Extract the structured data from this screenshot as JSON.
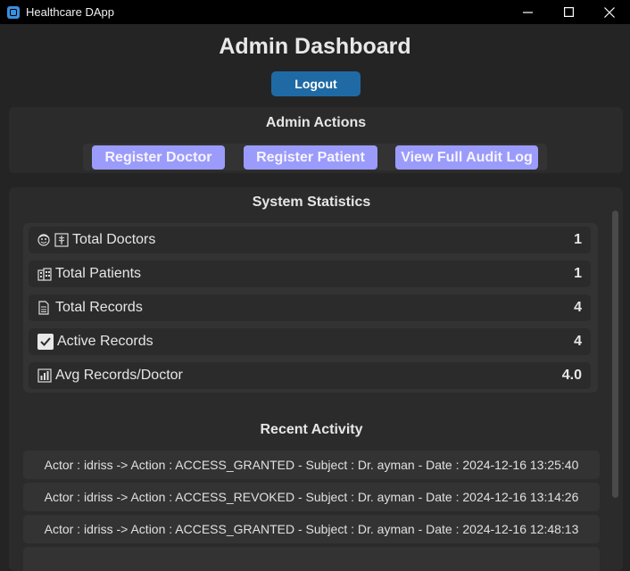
{
  "window": {
    "title": "Healthcare DApp",
    "controls": [
      "minimize",
      "maximize",
      "close"
    ]
  },
  "header": {
    "title": "Admin Dashboard",
    "logout_label": "Logout"
  },
  "admin_actions": {
    "title": "Admin Actions",
    "buttons": [
      {
        "label": "Register Doctor"
      },
      {
        "label": "Register Patient"
      },
      {
        "label": "View Full Audit Log"
      }
    ]
  },
  "statistics": {
    "title": "System Statistics",
    "items": [
      {
        "label": "Total Doctors",
        "value": "1",
        "icons": [
          "doctor-face-icon",
          "medical-badge-icon"
        ]
      },
      {
        "label": "Total Patients",
        "value": "1",
        "icons": [
          "hospital-icon"
        ]
      },
      {
        "label": "Total Records",
        "value": "4",
        "icons": [
          "document-icon"
        ]
      },
      {
        "label": "Active Records",
        "value": "4",
        "icons": [
          "checkmark-icon"
        ]
      },
      {
        "label": "Avg Records/Doctor",
        "value": "4.0",
        "icons": [
          "bar-chart-icon"
        ]
      }
    ]
  },
  "recent_activity": {
    "title": "Recent Activity",
    "items": [
      "Actor : idriss -> Action : ACCESS_GRANTED - Subject : Dr. ayman - Date : 2024-12-16 13:25:40",
      "Actor : idriss -> Action : ACCESS_REVOKED - Subject : Dr. ayman - Date : 2024-12-16 13:14:26",
      "Actor : idriss -> Action : ACCESS_GRANTED - Subject : Dr. ayman - Date : 2024-12-16 12:48:13"
    ]
  },
  "colors": {
    "background": "#242424",
    "panel": "#2b2b2b",
    "primary_button": "#1f6aa5",
    "action_button": "#9b9bfb"
  }
}
